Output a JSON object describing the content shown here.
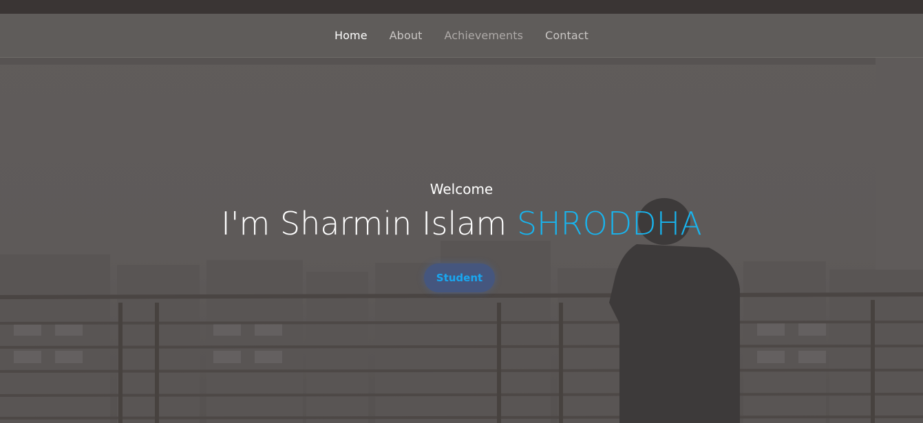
{
  "nav": {
    "items": [
      {
        "label": "Home",
        "state": "active"
      },
      {
        "label": "About",
        "state": "normal"
      },
      {
        "label": "Achievements",
        "state": "muted"
      },
      {
        "label": "Contact",
        "state": "normal"
      }
    ]
  },
  "hero": {
    "welcome": "Welcome",
    "name_prefix": "I'm Sharmin Islam",
    "name_accent": "SHRODDHA",
    "role": "Student"
  },
  "colors": {
    "accent": "#18b4ee",
    "overlay": "#5b5857",
    "badge_text": "#19a7f0"
  },
  "icons": {
    "background": "balcony-city-photo"
  }
}
